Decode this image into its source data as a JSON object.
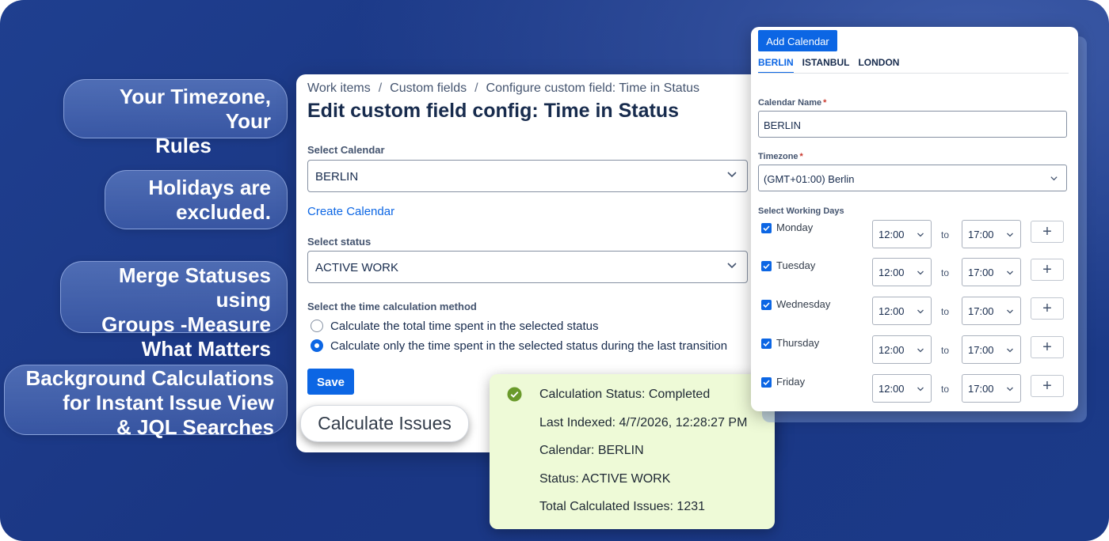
{
  "features": [
    {
      "lines": [
        "Your Timezone, Your",
        "Rules"
      ]
    },
    {
      "lines": [
        "Holidays are",
        "excluded."
      ]
    },
    {
      "lines": [
        "Merge Statuses using",
        "Groups -Measure",
        "What Matters"
      ]
    },
    {
      "lines": [
        "Background Calculations",
        "for Instant Issue View",
        "& JQL Searches"
      ]
    }
  ],
  "breadcrumb": [
    "Work items",
    "Custom fields",
    "Configure custom field: Time in Status"
  ],
  "breadcrumb_sep": "/",
  "page_title": "Edit custom field config: Time in Status",
  "select_calendar": {
    "label": "Select Calendar",
    "value": "BERLIN"
  },
  "create_calendar_link": "Create Calendar",
  "select_status": {
    "label": "Select status",
    "value": "ACTIVE WORK"
  },
  "calc_method": {
    "label": "Select the time calculation method",
    "options": [
      {
        "label": "Calculate the total time spent in the selected status",
        "selected": false
      },
      {
        "label": "Calculate only the time spent in the selected status during the last transition",
        "selected": true
      }
    ]
  },
  "save_label": "Save",
  "calculate_issues_label": "Calculate Issues",
  "status_popup": {
    "lines": [
      "Calculation Status: Completed",
      "Last Indexed: 4/7/2026, 12:28:27 PM",
      "Calendar: BERLIN",
      "Status: ACTIVE WORK",
      "Total Calculated Issues: 1231"
    ],
    "success_color": "#6a9a2b"
  },
  "calendar_panel": {
    "add_button": "Add Calendar",
    "tabs": [
      {
        "label": "BERLIN",
        "active": true
      },
      {
        "label": "ISTANBUL",
        "active": false
      },
      {
        "label": "LONDON",
        "active": false
      }
    ],
    "name_label": "Calendar Name",
    "name_value": "BERLIN",
    "timezone_label": "Timezone",
    "timezone_value": "(GMT+01:00) Berlin",
    "required_mark": "*",
    "working_days_label": "Select Working Days",
    "to_label": "to",
    "add_interval": "+",
    "days": [
      {
        "name": "Monday",
        "from": "12:00",
        "to": "17:00",
        "checked": true
      },
      {
        "name": "Tuesday",
        "from": "12:00",
        "to": "17:00",
        "checked": true
      },
      {
        "name": "Wednesday",
        "from": "12:00",
        "to": "17:00",
        "checked": true
      },
      {
        "name": "Thursday",
        "from": "12:00",
        "to": "17:00",
        "checked": true
      },
      {
        "name": "Friday",
        "from": "12:00",
        "to": "17:00",
        "checked": true
      }
    ]
  },
  "colors": {
    "primary": "#0c66e4",
    "background": "#1c3a88",
    "popup": "#eefad7"
  }
}
